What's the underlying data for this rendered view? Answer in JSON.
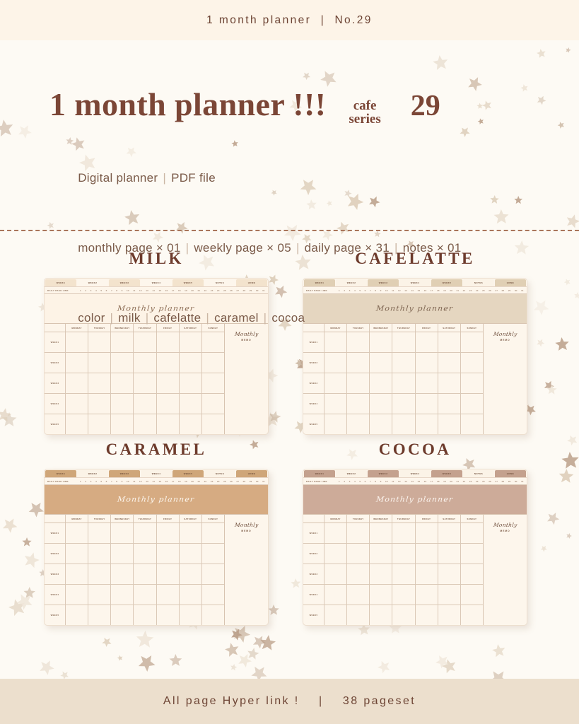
{
  "topbar": {
    "text": "1 month planner  |  No.29"
  },
  "hero": {
    "title": "1 month planner !!!",
    "series_line1": "cafe",
    "series_line2": "series",
    "number": "29",
    "line1_a": "Digital planner",
    "line1_b": "PDF file",
    "line2_a": "monthly page × 01",
    "line2_b": "weekly page × 05",
    "line2_c": "daily page × 31",
    "line2_d": "notes × 01",
    "line3_a": "color",
    "line3_b": "milk",
    "line3_c": "cafelatte",
    "line3_d": "caramel",
    "line3_e": "cocoa",
    "separator": "|",
    "title_color": "#7b4636",
    "text_color": "#7a5a48"
  },
  "previews": {
    "planner_tabs": [
      "WEEK1",
      "WEEK2",
      "WEEK3",
      "WEEK4",
      "WEEK5",
      "NOTES",
      "HOME"
    ],
    "link_label": "DAILY PAGE LINK",
    "link_numbers": [
      "1",
      "2",
      "3",
      "4",
      "5",
      "6",
      "7",
      "8",
      "9",
      "10",
      "11",
      "12",
      "13",
      "14",
      "15",
      "16",
      "17",
      "18",
      "19",
      "20",
      "21",
      "22",
      "23",
      "24",
      "25",
      "26",
      "27",
      "28",
      "29",
      "30",
      "31"
    ],
    "band_title": "Monthly planner",
    "weekdays": [
      "MONDAY",
      "TUESDAY",
      "WEDNESDAY",
      "THURSDAY",
      "FRIDAY",
      "SATURDAY",
      "SUNDAY"
    ],
    "weeks": [
      "WEEK1",
      "WEEK2",
      "WEEK3",
      "WEEK4",
      "WEEK5"
    ],
    "memo_script": "Monthly",
    "memo_sub": "MEMO",
    "items": [
      {
        "name": "MILK",
        "band_bg": "#fdf3e6",
        "band_text": "#8a6a52",
        "tab_on": "#f3e3cd",
        "tab_off": "#fdf6ec",
        "card_bg": "#fdf5ea"
      },
      {
        "name": "CAFELATTE",
        "band_bg": "#e5d6c0",
        "band_text": "#7d6450",
        "tab_on": "#e0cfb4",
        "tab_off": "#fbf3e7",
        "card_bg": "#fdf6ec"
      },
      {
        "name": "CARAMEL",
        "band_bg": "#d6ab82",
        "band_text": "#fdf7ef",
        "tab_on": "#cfa679",
        "tab_off": "#fbf3e7",
        "card_bg": "#fdf6ec"
      },
      {
        "name": "COCOA",
        "band_bg": "#cdab99",
        "band_text": "#fdf6f0",
        "tab_on": "#c4a18e",
        "tab_off": "#fbf3e7",
        "card_bg": "#fdf6ec"
      }
    ]
  },
  "footer": {
    "text": "All page Hyper link !    |    38 pageset"
  },
  "theme": {
    "page_bg": "#fdfaf4",
    "topbar_bg": "#fdf4e8",
    "footer_bg": "#ecdfcd",
    "divider_color": "#a9755a",
    "star_colors": [
      "#e8dccb",
      "#dfd0bc",
      "#cdb9a4",
      "#bda28c",
      "#f0e7da"
    ]
  }
}
